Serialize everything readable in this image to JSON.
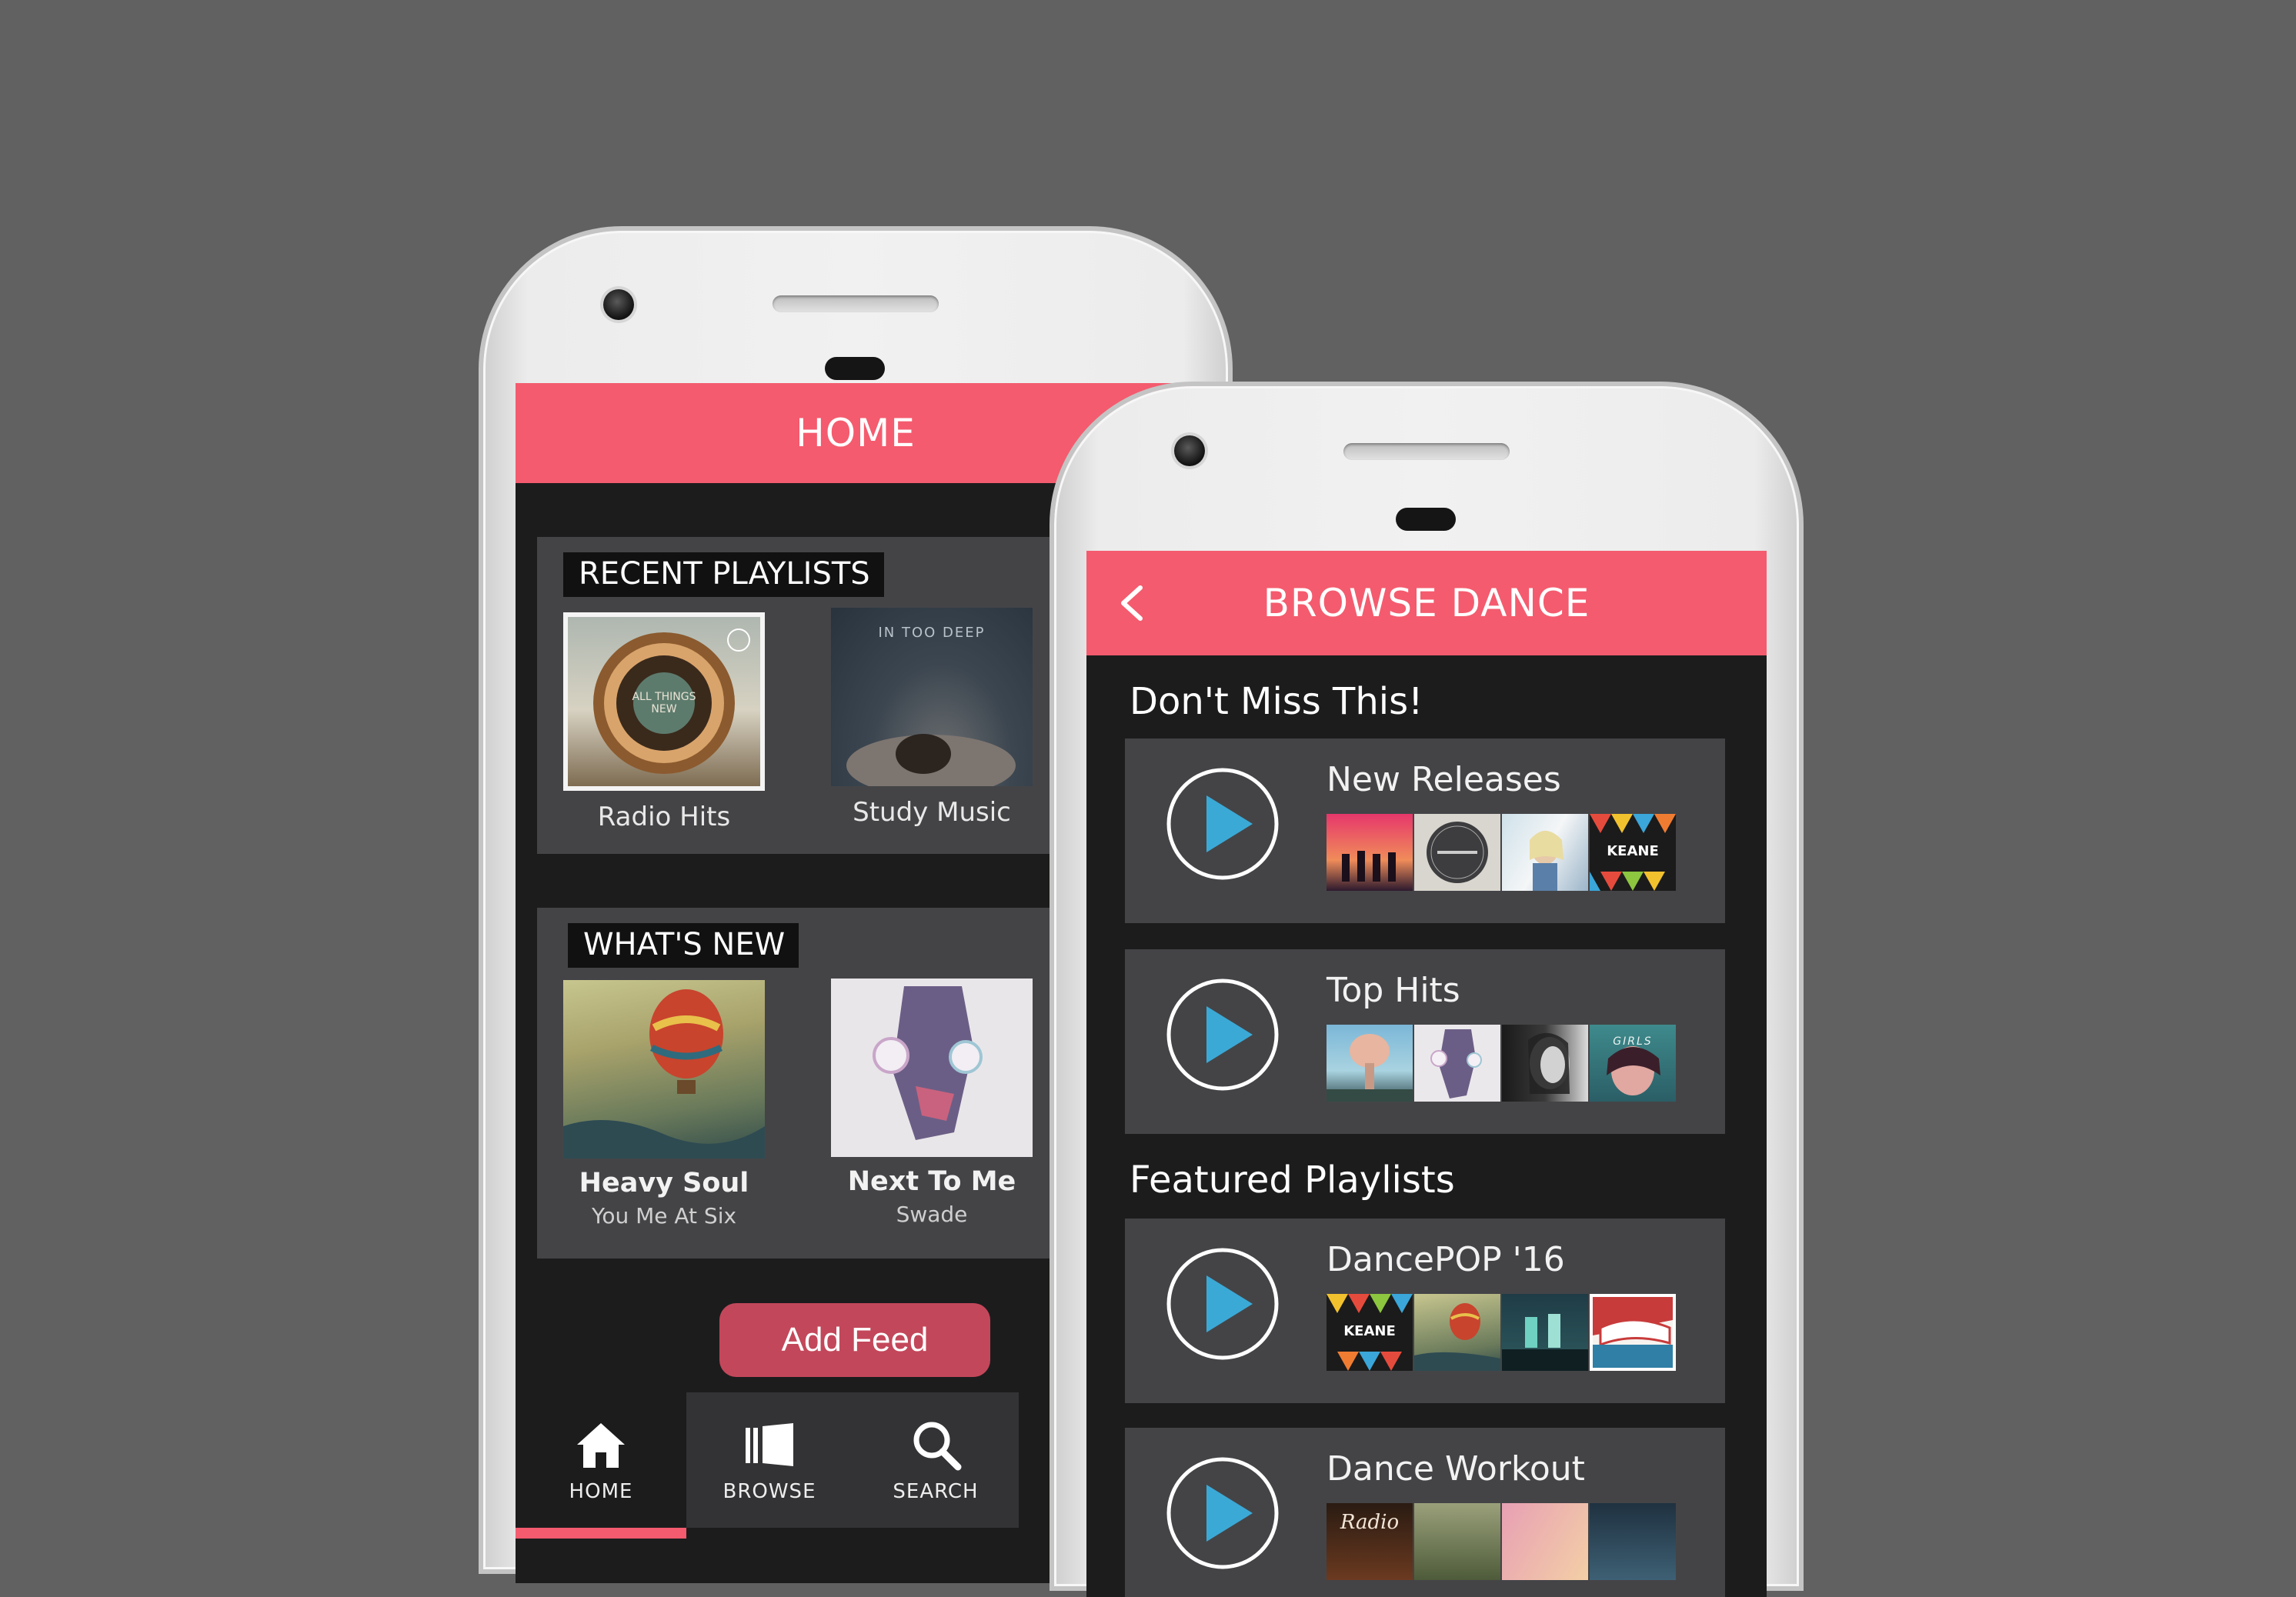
{
  "home_screen": {
    "title": "HOME",
    "recent_playlists": {
      "heading": "RECENT PLAYLISTS",
      "items": [
        {
          "label": "Radio Hits",
          "art_text": "ALL THINGS NEW"
        },
        {
          "label": "Study Music",
          "art_text": "IN TOO DEEP"
        }
      ]
    },
    "whats_new": {
      "heading": "WHAT'S NEW",
      "items": [
        {
          "title": "Heavy Soul",
          "artist": "You Me At Six"
        },
        {
          "title": "Next To Me",
          "artist": "Swade"
        }
      ]
    },
    "add_feed_label": "Add Feed",
    "nav": [
      {
        "label": "HOME",
        "icon": "home-icon",
        "active": true
      },
      {
        "label": "BROWSE",
        "icon": "browse-icon",
        "active": false
      },
      {
        "label": "SEARCH",
        "icon": "search-icon",
        "active": false
      }
    ]
  },
  "browse_screen": {
    "title": "BROWSE DANCE",
    "sections": [
      {
        "heading": "Don't Miss This!",
        "rows": [
          {
            "title": "New Releases"
          },
          {
            "title": "Top Hits"
          }
        ]
      },
      {
        "heading": "Featured Playlists",
        "rows": [
          {
            "title": "DancePOP '16"
          },
          {
            "title": "Dance Workout"
          }
        ]
      }
    ],
    "thumb_text": {
      "keane": "KEANE",
      "girls": "GIRLS",
      "radio": "Radio"
    }
  },
  "colors": {
    "accent": "#f45b6e",
    "add_feed": "#c3475a",
    "play": "#3ba9d6",
    "background": "#616161",
    "screen": "#1c1c1d",
    "card": "#444447"
  }
}
